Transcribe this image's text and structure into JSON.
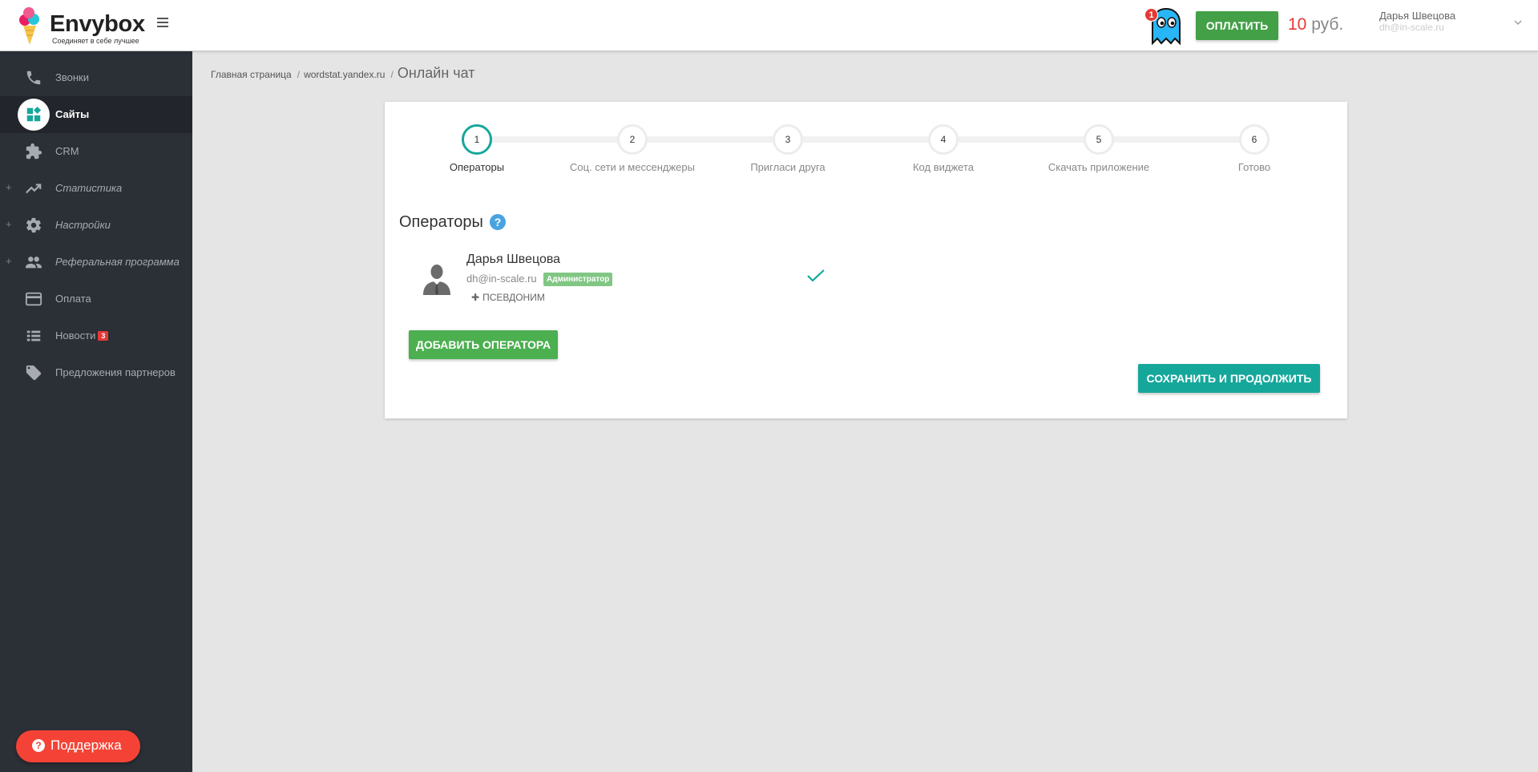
{
  "brand": {
    "name": "Envybox",
    "tagline": "Соединяет в себе лучшее"
  },
  "header": {
    "notifications_count": "1",
    "pay_label": "ОПЛАТИТЬ",
    "balance_amount": "10",
    "balance_currency": " руб.",
    "user_name": "Дарья Швецова",
    "user_email": "dh@in-scale.ru"
  },
  "sidebar": {
    "items": [
      {
        "label": "Звонки",
        "icon": "phone-icon"
      },
      {
        "label": "Сайты",
        "icon": "widgets-icon",
        "active": true
      },
      {
        "label": "CRM",
        "icon": "puzzle-icon"
      },
      {
        "label": "Статистика",
        "icon": "trending-up-icon",
        "expandable": true
      },
      {
        "label": "Настройки",
        "icon": "gear-icon",
        "expandable": true
      },
      {
        "label": "Реферальная программа",
        "icon": "people-icon",
        "expandable": true
      },
      {
        "label": "Оплата",
        "icon": "credit-card-icon"
      },
      {
        "label": "Новости",
        "icon": "list-icon",
        "badge": "3"
      },
      {
        "label": "Предложения партнеров",
        "icon": "tag-icon"
      }
    ],
    "support_label": "Поддержка"
  },
  "breadcrumb": {
    "home": "Главная страница",
    "site": "wordstat.yandex.ru",
    "current": "Онлайн чат"
  },
  "wizard": {
    "active_step": 1,
    "steps": [
      {
        "number": "1",
        "label": "Операторы"
      },
      {
        "number": "2",
        "label": "Соц. сети и мессенджеры"
      },
      {
        "number": "3",
        "label": "Пригласи друга"
      },
      {
        "number": "4",
        "label": "Код виджета"
      },
      {
        "number": "5",
        "label": "Скачать приложение"
      },
      {
        "number": "6",
        "label": "Готово"
      }
    ]
  },
  "operators": {
    "title": "Операторы",
    "help": "?",
    "list": [
      {
        "name": "Дарья Швецова",
        "email": "dh@in-scale.ru",
        "role": "Администратор",
        "alias_label": "ПСЕВДОНИМ"
      }
    ],
    "add_label": "ДОБАВИТЬ ОПЕРАТОРА",
    "save_label": "СОХРАНИТЬ И ПРОДОЛЖИТЬ"
  },
  "colors": {
    "accent": "#16a79b",
    "green": "#4caf50",
    "danger": "#e53935",
    "sidebar_bg": "#2b2f36"
  }
}
